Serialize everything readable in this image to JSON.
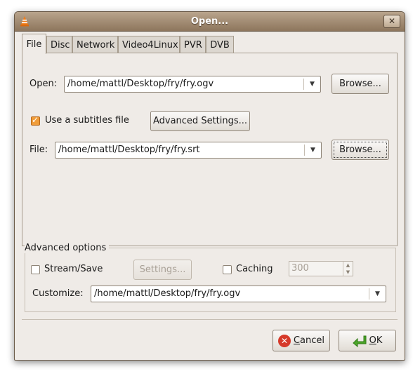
{
  "window": {
    "title": "Open..."
  },
  "tabs": [
    {
      "label": "File",
      "active": true
    },
    {
      "label": "Disc",
      "active": false
    },
    {
      "label": "Network",
      "active": false
    },
    {
      "label": "Video4Linux",
      "active": false
    },
    {
      "label": "PVR",
      "active": false
    },
    {
      "label": "DVB",
      "active": false
    }
  ],
  "file_tab": {
    "open_label": "Open:",
    "open_value": "/home/mattl/Desktop/fry/fry.ogv",
    "browse_label": "Browse...",
    "subtitles_label": "Use a subtitles file",
    "subtitles_checked": true,
    "advanced_settings_label": "Advanced Settings...",
    "file_label": "File:",
    "file_value": "/home/mattl/Desktop/fry/fry.srt",
    "browse2_label": "Browse..."
  },
  "advanced": {
    "legend": "Advanced options",
    "stream_save_label": "Stream/Save",
    "stream_save_checked": false,
    "settings_label": "Settings...",
    "caching_label": "Caching",
    "caching_checked": false,
    "caching_value": "300",
    "customize_label": "Customize:",
    "customize_value": "/home/mattl/Desktop/fry/fry.ogv"
  },
  "buttons": {
    "cancel_mnemonic": "C",
    "cancel_rest": "ancel",
    "ok_mnemonic": "O",
    "ok_rest": "K"
  },
  "icons": {
    "app": "vlc-cone-icon",
    "close": "close-icon",
    "cancel": "cancel-icon",
    "ok": "ok-arrow-icon",
    "dropdown": "chevron-down-icon"
  },
  "colors": {
    "titlebar": "#a08a72",
    "checkbox_checked": "#f09d3a",
    "cancel_icon": "#d63a2a",
    "ok_icon": "#4ca62a"
  }
}
